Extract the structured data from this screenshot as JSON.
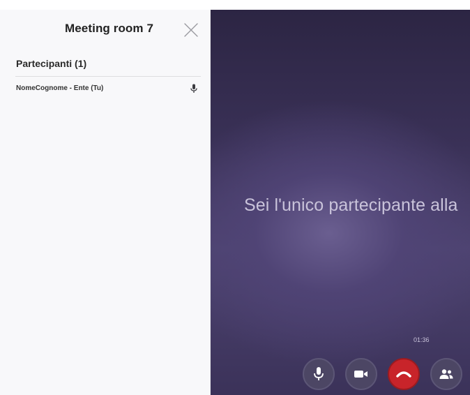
{
  "sidebar": {
    "title": "Meeting room 7",
    "participants_heading": "Partecipanti (1)",
    "participants": [
      {
        "name": "NomeCognome - Ente (Tu)",
        "icon": "microphone-icon"
      }
    ],
    "close_icon": "close-icon"
  },
  "stage": {
    "message": "Sei l'unico partecipante alla",
    "timer": "01:36"
  },
  "controls": [
    {
      "name": "microphone",
      "icon": "microphone-icon"
    },
    {
      "name": "camera",
      "icon": "video-camera-icon"
    },
    {
      "name": "hang-up",
      "icon": "phone-hangup-icon",
      "color": "#c8242a"
    },
    {
      "name": "participants",
      "icon": "people-icon"
    }
  ],
  "colors": {
    "stage_background": "#3b3259",
    "hangup": "#c8242a",
    "sidebar_background": "#f8f8fa"
  }
}
